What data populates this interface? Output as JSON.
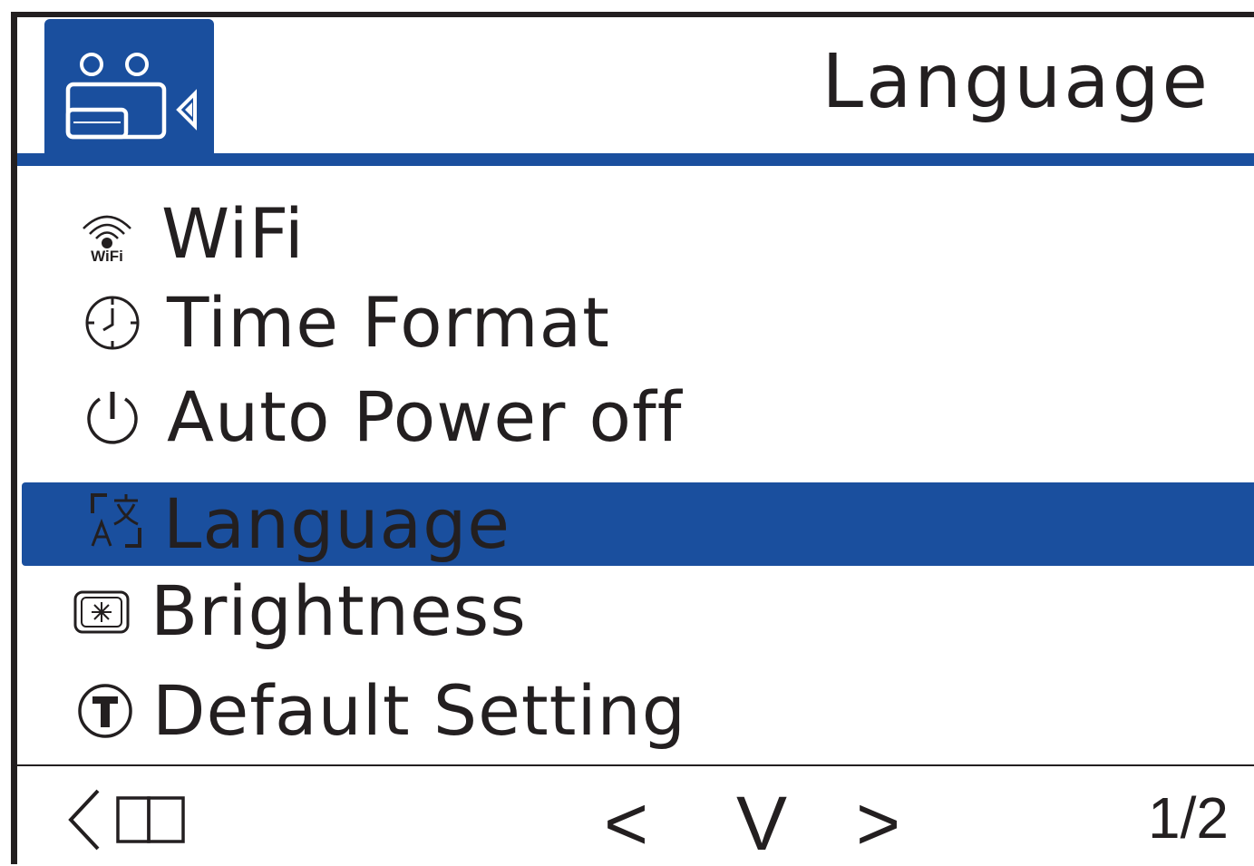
{
  "header": {
    "title": "Language",
    "tab_icon": "settings-tab-icon"
  },
  "menu": {
    "items": [
      {
        "label": "WiFi",
        "icon": "wifi-icon",
        "icon_caption": "WiFi",
        "selected": false
      },
      {
        "label": "Time Format",
        "icon": "clock-icon",
        "selected": false
      },
      {
        "label": "Auto Power off",
        "icon": "power-icon",
        "selected": false
      },
      {
        "label": "Language",
        "icon": "language-icon",
        "selected": true
      },
      {
        "label": "Brightness",
        "icon": "brightness-icon",
        "selected": false
      },
      {
        "label": "Default Setting",
        "icon": "default-setting-icon",
        "selected": false
      }
    ]
  },
  "footer": {
    "back_icon": "back-icon",
    "prev_label": "<",
    "down_label": "V",
    "next_label": ">",
    "page_indicator": "1/2"
  },
  "colors": {
    "accent": "#1a4f9e",
    "text": "#231f20",
    "background": "#ffffff"
  }
}
